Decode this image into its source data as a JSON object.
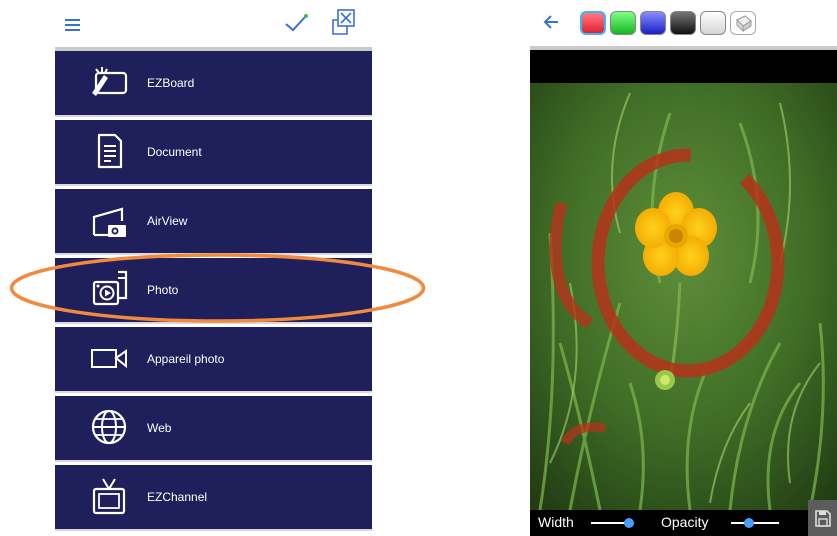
{
  "left_panel": {
    "menu_items": [
      {
        "label": "EZBoard",
        "icon": "board-pen-icon"
      },
      {
        "label": "Document",
        "icon": "document-icon"
      },
      {
        "label": "AirView",
        "icon": "airview-projector-icon"
      },
      {
        "label": "Photo",
        "icon": "photo-icon"
      },
      {
        "label": "Appareil photo",
        "icon": "video-camera-icon"
      },
      {
        "label": "Web",
        "icon": "globe-icon"
      },
      {
        "label": "EZChannel",
        "icon": "tv-icon"
      }
    ],
    "highlighted_item": "Photo",
    "highlight_color": "#f08a3c",
    "menu_bg_color": "#1f1f5b",
    "accent_color": "#3a6fd8"
  },
  "right_panel": {
    "swatches": [
      {
        "name": "red",
        "color": "#f23a4a",
        "selected": true
      },
      {
        "name": "green",
        "color": "#2fcf3a",
        "selected": false
      },
      {
        "name": "blue",
        "color": "#3a3fe0",
        "selected": false
      },
      {
        "name": "black",
        "color": "#222222",
        "selected": false
      },
      {
        "name": "white",
        "color": "#f0f0f0",
        "selected": false
      },
      {
        "name": "eraser",
        "color": "#ffffff",
        "selected": false
      }
    ],
    "bottom_bar": {
      "width_label": "Width",
      "opacity_label": "Opacity",
      "width_value": 0.85,
      "opacity_value": 0.4
    },
    "annotation_color": "#b5331a"
  }
}
